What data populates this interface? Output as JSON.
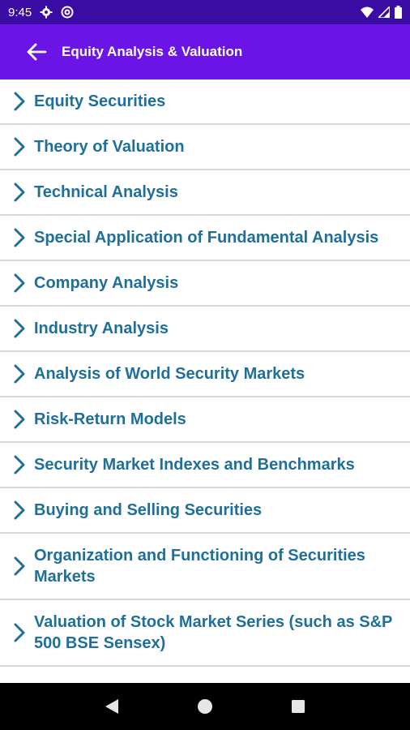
{
  "status_bar": {
    "time": "9:45",
    "icons": [
      "settings-icon",
      "at-icon",
      "wifi-icon",
      "signal-icon",
      "battery-icon"
    ]
  },
  "app_bar": {
    "title": "Equity Analysis & Valuation",
    "back_icon": "arrow-left-icon"
  },
  "topics": [
    {
      "label": "Equity Securities"
    },
    {
      "label": "Theory of Valuation"
    },
    {
      "label": "Technical Analysis"
    },
    {
      "label": "Special Application of Fundamental Analysis"
    },
    {
      "label": "Company Analysis"
    },
    {
      "label": "Industry Analysis"
    },
    {
      "label": "Analysis of World Security Markets"
    },
    {
      "label": "Risk-Return Models"
    },
    {
      "label": "Security Market Indexes and Benchmarks"
    },
    {
      "label": "Buying and Selling Securities"
    },
    {
      "label": "Organization and Functioning of Securities Markets"
    },
    {
      "label": "Valuation of Stock Market Series (such as S&P 500 BSE Sensex)"
    }
  ],
  "nav_bar": {
    "icons": [
      "back-triangle-icon",
      "home-circle-icon",
      "recents-square-icon"
    ]
  },
  "colors": {
    "status_bar": "#3a0ca3",
    "app_bar": "#6a14e6",
    "item_text": "#1f6f99",
    "divider": "#d9d9d9"
  }
}
